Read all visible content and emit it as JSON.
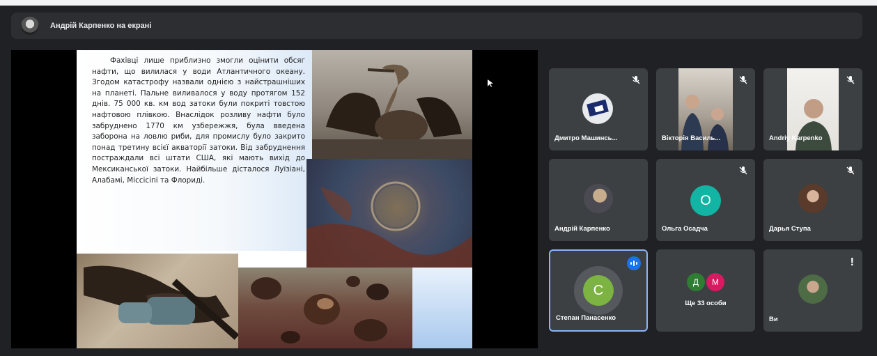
{
  "header": {
    "title": "Андрій Карпенко на екрані"
  },
  "slide": {
    "text": "Фахівці лише приблизно змогли оцінити обсяг нафти, що вилилася у води Атлантичного океану. Згодом катастрофу назвали однією з найстрашніших на планеті. Пальне виливалося у воду протягом 152 днів. 75 000 кв. км вод затоки були покриті товстою нафтовою плівкою. Внаслідок розливу нафти було забруднено 1770 км узбережжя, була введена заборона на ловлю риби, для промислу було закрито понад третину всієї акваторії затоки. Від забруднення постраждали всі штати США, які мають вихід до Мексиканської затоки. Найбільше дісталося Луїзіані, Алабамі, Міссісіпі та Флориді."
  },
  "participants": [
    {
      "name": "Дмитро Машинсь...",
      "muted": true
    },
    {
      "name": "Вікторія Василь...",
      "muted": true
    },
    {
      "name": "Andriy Karpenko",
      "muted": true
    },
    {
      "name": "Андрій Карпенко",
      "muted": false
    },
    {
      "name": "Ольга Осадча",
      "initial": "О",
      "color": "#12b5a3",
      "muted": true
    },
    {
      "name": "Дарья Ступа",
      "muted": true
    },
    {
      "name": "Степан Панасенко",
      "initial": "С",
      "color": "#7cb342",
      "speaking": true
    },
    {
      "name": "Ще 33 особи",
      "initials": [
        "Д",
        "М"
      ],
      "colors": [
        "#2e7d32",
        "#d81b60"
      ]
    },
    {
      "name": "Ви",
      "alert": "!"
    }
  ],
  "colors": {
    "background": "#202124",
    "tile": "#3c4043",
    "active_border": "#8ab4f8",
    "speaking_badge": "#1a73e8"
  }
}
